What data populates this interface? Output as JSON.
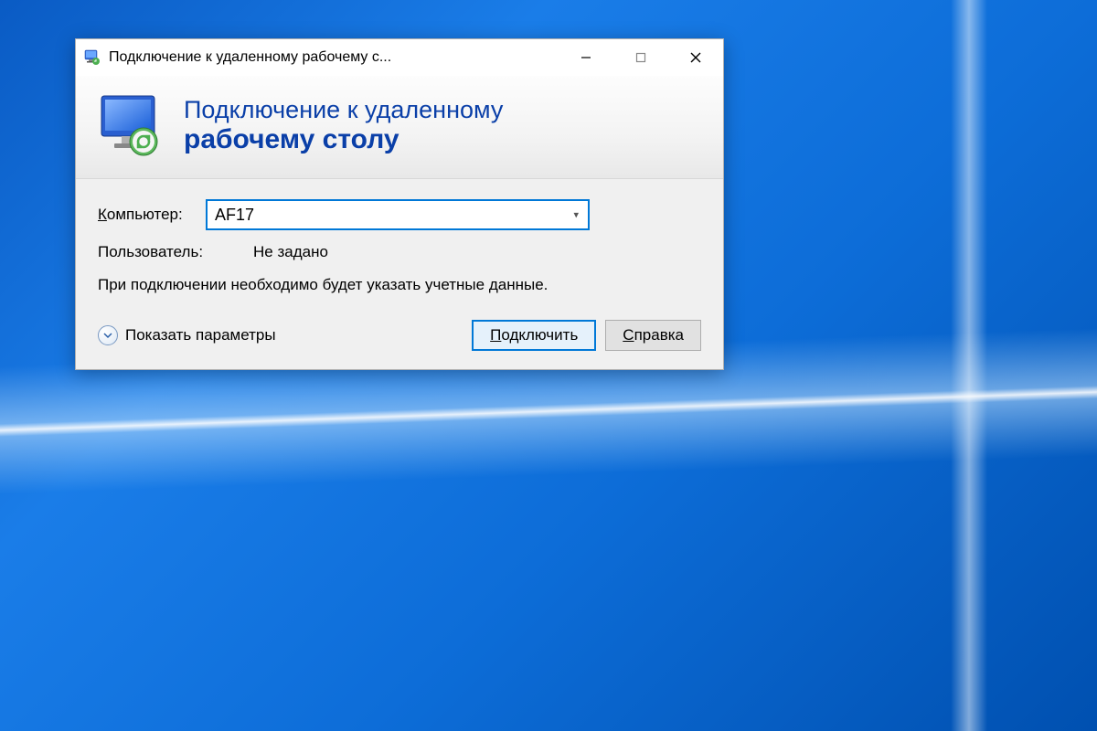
{
  "titlebar": {
    "title": "Подключение к удаленному рабочему с..."
  },
  "banner": {
    "line1": "Подключение к удаленному",
    "line2": "рабочему столу"
  },
  "form": {
    "computer_label_prefix": "К",
    "computer_label_rest": "омпьютер:",
    "computer_value": "AF17",
    "user_label": "Пользователь:",
    "user_value": "Не задано",
    "info_text": "При подключении необходимо будет указать учетные данные."
  },
  "footer": {
    "show_options_prefix": "П",
    "show_options_rest": "оказать параметры",
    "connect_prefix": "П",
    "connect_rest": "одключить",
    "help_prefix": "С",
    "help_rest": "правка"
  }
}
